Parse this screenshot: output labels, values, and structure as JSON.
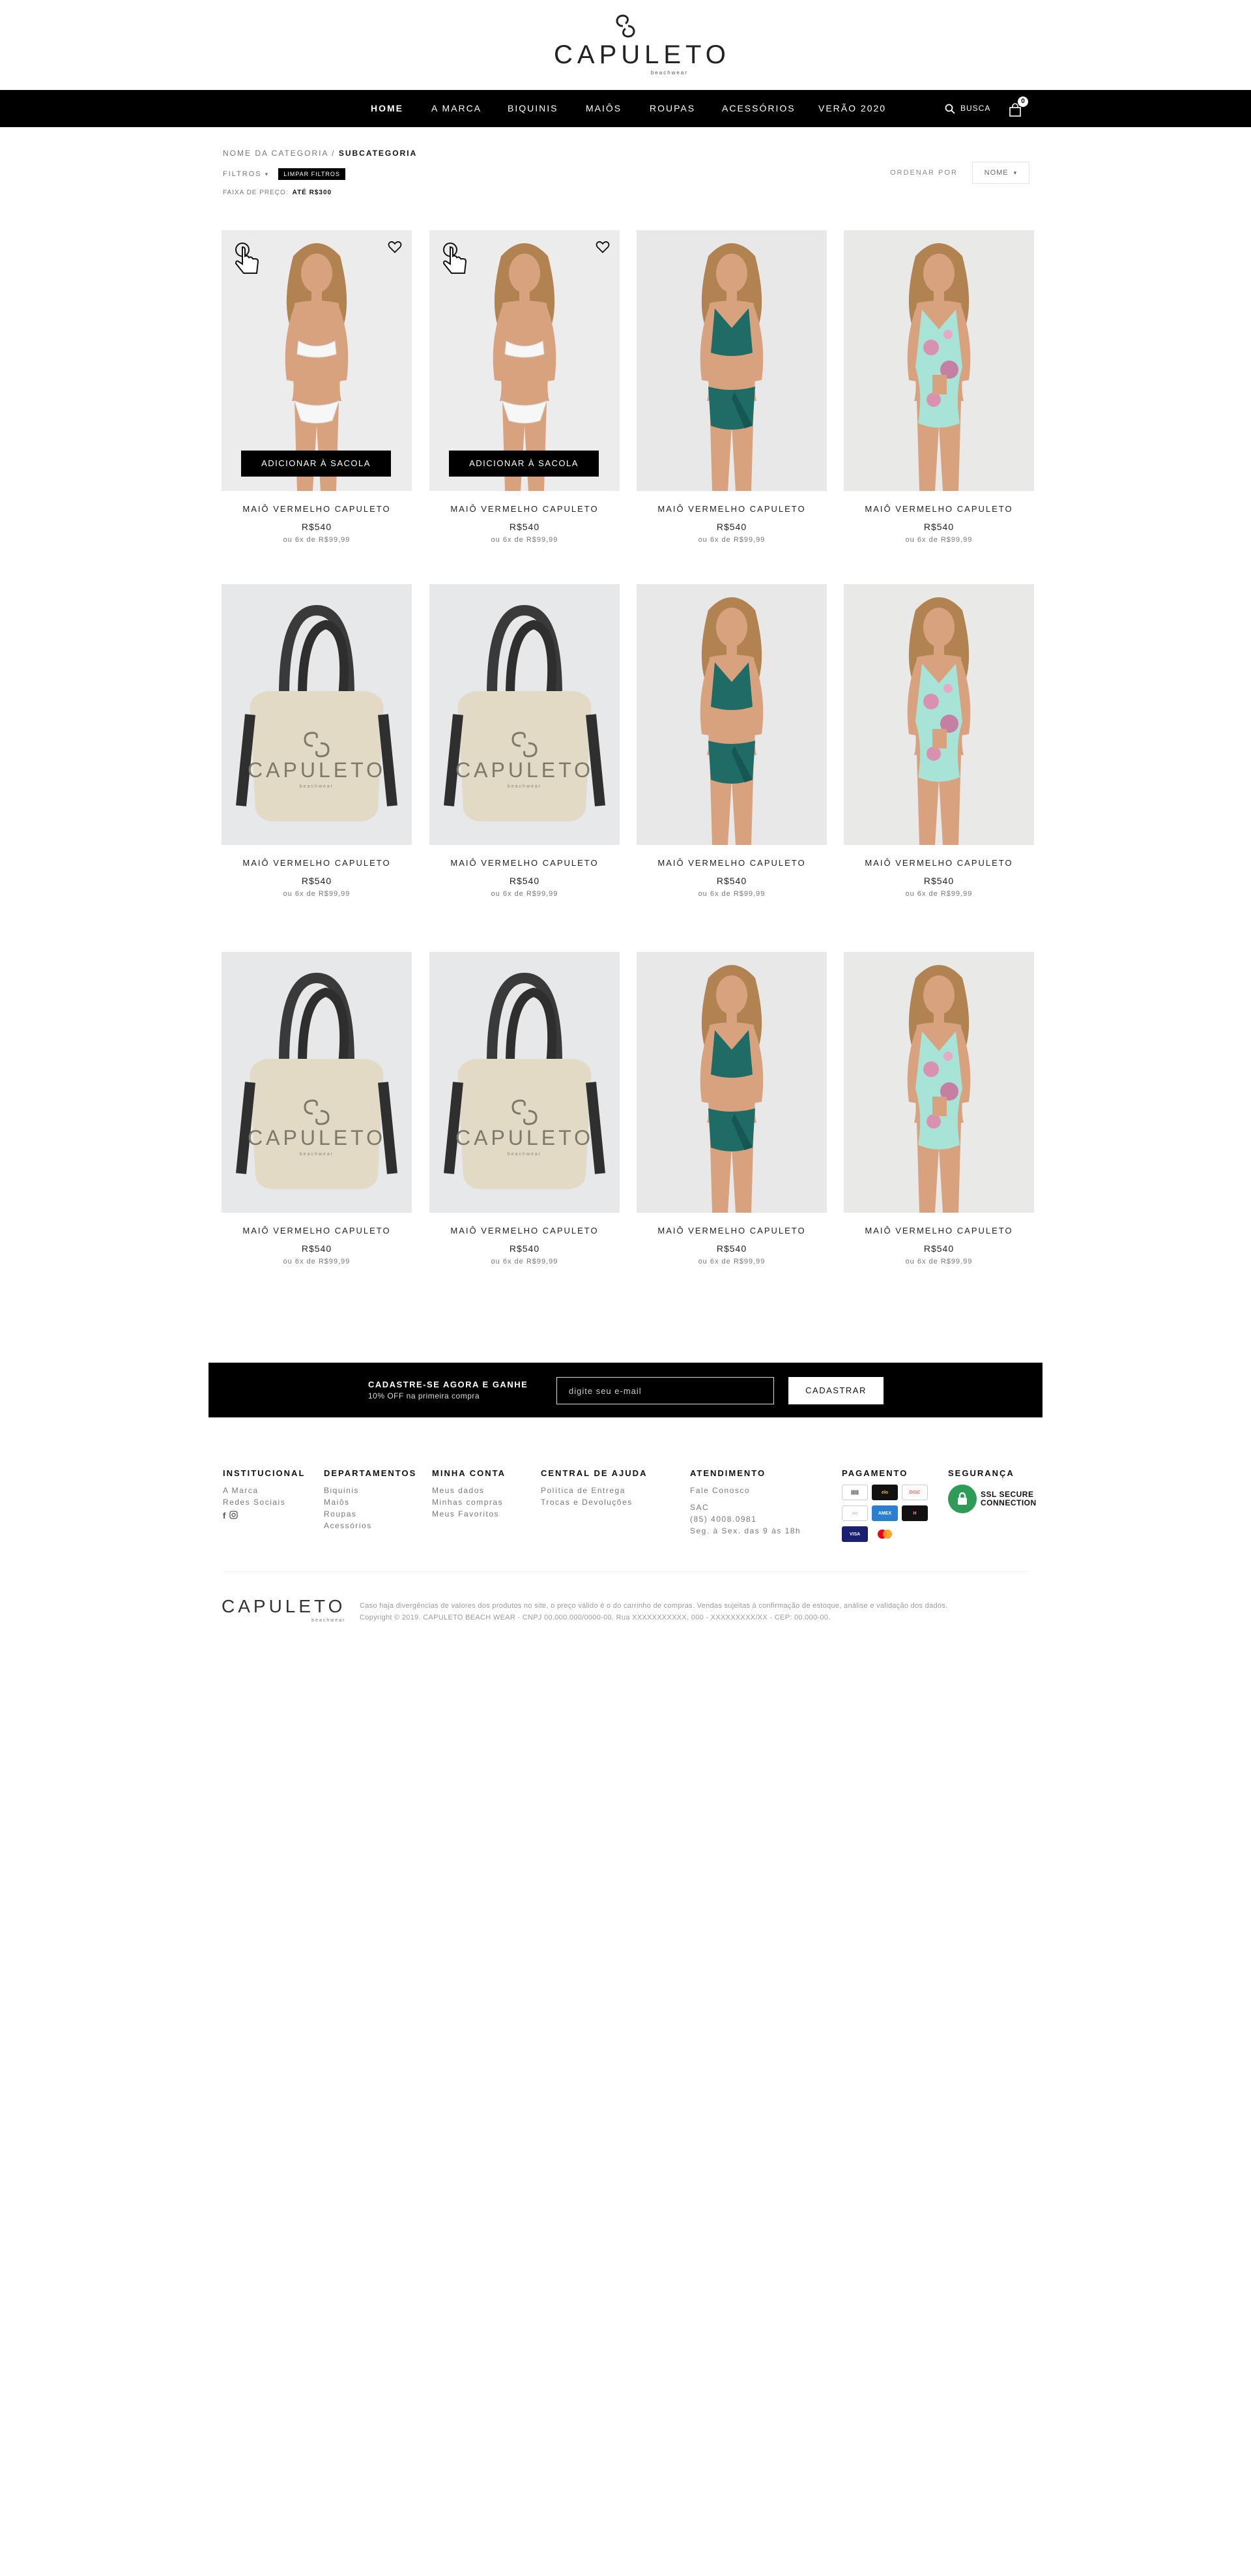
{
  "brand": {
    "name": "CAPULETO",
    "tagline": "beachwear"
  },
  "nav": {
    "items": [
      "HOME",
      "A MARCA",
      "BIQUINIS",
      "MAIÔS",
      "ROUPAS",
      "ACESSÓRIOS",
      "VERÃO 2020"
    ],
    "active": "HOME",
    "search_label": "BUSCA",
    "bag_count": "0"
  },
  "toolbar": {
    "breadcrumb_parent": "NOME DA CATEGORIA /",
    "breadcrumb_current": "SUBCATEGORIA",
    "filters_label": "FILTROS",
    "clear_filters": "LIMPAR FILTROS",
    "price_range_label": "FAIXA DE PREÇO:",
    "price_range_value": "ATÉ R$300",
    "sort_label": "ORDENAR POR",
    "sort_value": "NOME"
  },
  "products": [
    {
      "name": "MAIÔ VERMELHO CAPULETO",
      "price": "R$540",
      "installment": "ou 6x de R$99,99",
      "image": "white-bikini",
      "hover": true,
      "add_to_bag": "ADICIONAR À SACOLA"
    },
    {
      "name": "MAIÔ VERMELHO CAPULETO",
      "price": "R$540",
      "installment": "ou 6x de R$99,99",
      "image": "white-bikini",
      "hover": true,
      "add_to_bag": "ADICIONAR À SACOLA"
    },
    {
      "name": "MAIÔ VERMELHO CAPULETO",
      "price": "R$540",
      "installment": "ou 6x de R$99,99",
      "image": "green-bikini",
      "hover": false
    },
    {
      "name": "MAIÔ VERMELHO CAPULETO",
      "price": "R$540",
      "installment": "ou 6x de R$99,99",
      "image": "floral-swimsuit",
      "hover": false
    },
    {
      "name": "MAIÔ VERMELHO CAPULETO",
      "price": "R$540",
      "installment": "ou 6x de R$99,99",
      "image": "tote-bag",
      "hover": false
    },
    {
      "name": "MAIÔ VERMELHO CAPULETO",
      "price": "R$540",
      "installment": "ou 6x de R$99,99",
      "image": "tote-bag",
      "hover": false
    },
    {
      "name": "MAIÔ VERMELHO CAPULETO",
      "price": "R$540",
      "installment": "ou 6x de R$99,99",
      "image": "green-bikini",
      "hover": false
    },
    {
      "name": "MAIÔ VERMELHO CAPULETO",
      "price": "R$540",
      "installment": "ou 6x de R$99,99",
      "image": "floral-swimsuit",
      "hover": false
    },
    {
      "name": "MAIÔ VERMELHO CAPULETO",
      "price": "R$540",
      "installment": "ou 6x de R$99,99",
      "image": "tote-bag",
      "hover": false
    },
    {
      "name": "MAIÔ VERMELHO CAPULETO",
      "price": "R$540",
      "installment": "ou 6x de R$99,99",
      "image": "tote-bag",
      "hover": false
    },
    {
      "name": "MAIÔ VERMELHO CAPULETO",
      "price": "R$540",
      "installment": "ou 6x de R$99,99",
      "image": "green-bikini",
      "hover": false
    },
    {
      "name": "MAIÔ VERMELHO CAPULETO",
      "price": "R$540",
      "installment": "ou 6x de R$99,99",
      "image": "floral-swimsuit",
      "hover": false
    }
  ],
  "newsletter": {
    "title": "CADASTRE-SE AGORA E GANHE",
    "subtitle": "10% OFF na primeira compra",
    "placeholder": "digite seu e-mail",
    "button": "CADASTRAR"
  },
  "footer": {
    "institucional": {
      "title": "INSTITUCIONAL",
      "links": [
        "A Marca",
        "Redes Sociais"
      ]
    },
    "departamentos": {
      "title": "DEPARTAMENTOS",
      "links": [
        "Biquinis",
        "Maiôs",
        "Roupas",
        "Acessórios"
      ]
    },
    "minha_conta": {
      "title": "MINHA CONTA",
      "links": [
        "Meus dados",
        "Minhas compras",
        "Meus Favoritos"
      ]
    },
    "central": {
      "title": "CENTRAL DE AJUDA",
      "links": [
        "Política de Entrega",
        "Trocas e Devoluções"
      ]
    },
    "atendimento": {
      "title": "ATENDIMENTO",
      "contact": "Fale Conosco",
      "sac": "SAC",
      "phone": "(85) 4008.0981",
      "hours": "Seg. à Sex. das 9 às 18h"
    },
    "pagamento": {
      "title": "PAGAMENTO",
      "methods": [
        "Boleto",
        "Elo",
        "Discover",
        "Diners",
        "Amex",
        "Hipercard",
        "Visa",
        "Mastercard"
      ]
    },
    "seguranca": {
      "title": "SEGURANÇA",
      "ssl_line1": "SSL SECURE",
      "ssl_line2": "CONNECTION"
    },
    "legal_line1": "Caso haja divergências de valores dos produtos no site, o preço válido é o do carrinho de compras. Vendas sujeitas à confirmação de estoque, análise e validação dos dados.",
    "legal_line2": "Copyright © 2019. CAPULETO BEACH WEAR - CNPJ 00.000.000/0000-00. Rua XXXXXXXXXXX, 000 - XXXXXXXXX/XX - CEP: 00.000-00."
  },
  "colors": {
    "nav_bg": "#000000",
    "accent": "#000000",
    "ssl_green": "#2e9b56",
    "swim_green": "#1f6b66",
    "floral_mint": "#a8e3d8"
  }
}
